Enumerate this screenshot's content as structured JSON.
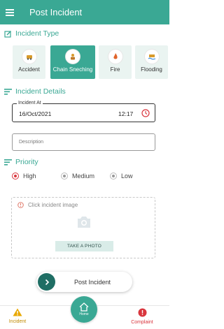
{
  "appbar": {
    "title": "Post Incident",
    "menu_icon": "hamburger-menu-icon"
  },
  "sections": {
    "incident_type": "Incident Type",
    "incident_details": "Incident Details",
    "priority": "Priority"
  },
  "incident_types": [
    {
      "label": "Accident",
      "icon": "accident-icon",
      "selected": false
    },
    {
      "label": "Chain Sneching",
      "icon": "chain-snatching-icon",
      "selected": true
    },
    {
      "label": "Fire",
      "icon": "fire-icon",
      "selected": false
    },
    {
      "label": "Flooding",
      "icon": "flood-icon",
      "selected": false
    }
  ],
  "incident_at": {
    "legend": "Incident At",
    "date": "16/Oct/2021",
    "time": "12:17",
    "icon": "clock-icon"
  },
  "description": {
    "placeholder": "Description"
  },
  "priority": {
    "options": [
      "High",
      "Medium",
      "Low"
    ],
    "selected": "High"
  },
  "photo": {
    "hint": "Click incident image",
    "button": "TAKE A PHOTO",
    "icon": "camera-icon"
  },
  "post_button": {
    "label": "Post Incident",
    "icon": "chevron-right-icon"
  },
  "bottom_nav": {
    "incident": "Incident",
    "home": "Home",
    "complaint": "Complaint"
  },
  "colors": {
    "primary": "#3aa894",
    "dark": "#1f6e64",
    "high": "#d9363e",
    "incident_nav": "#c08a00"
  }
}
